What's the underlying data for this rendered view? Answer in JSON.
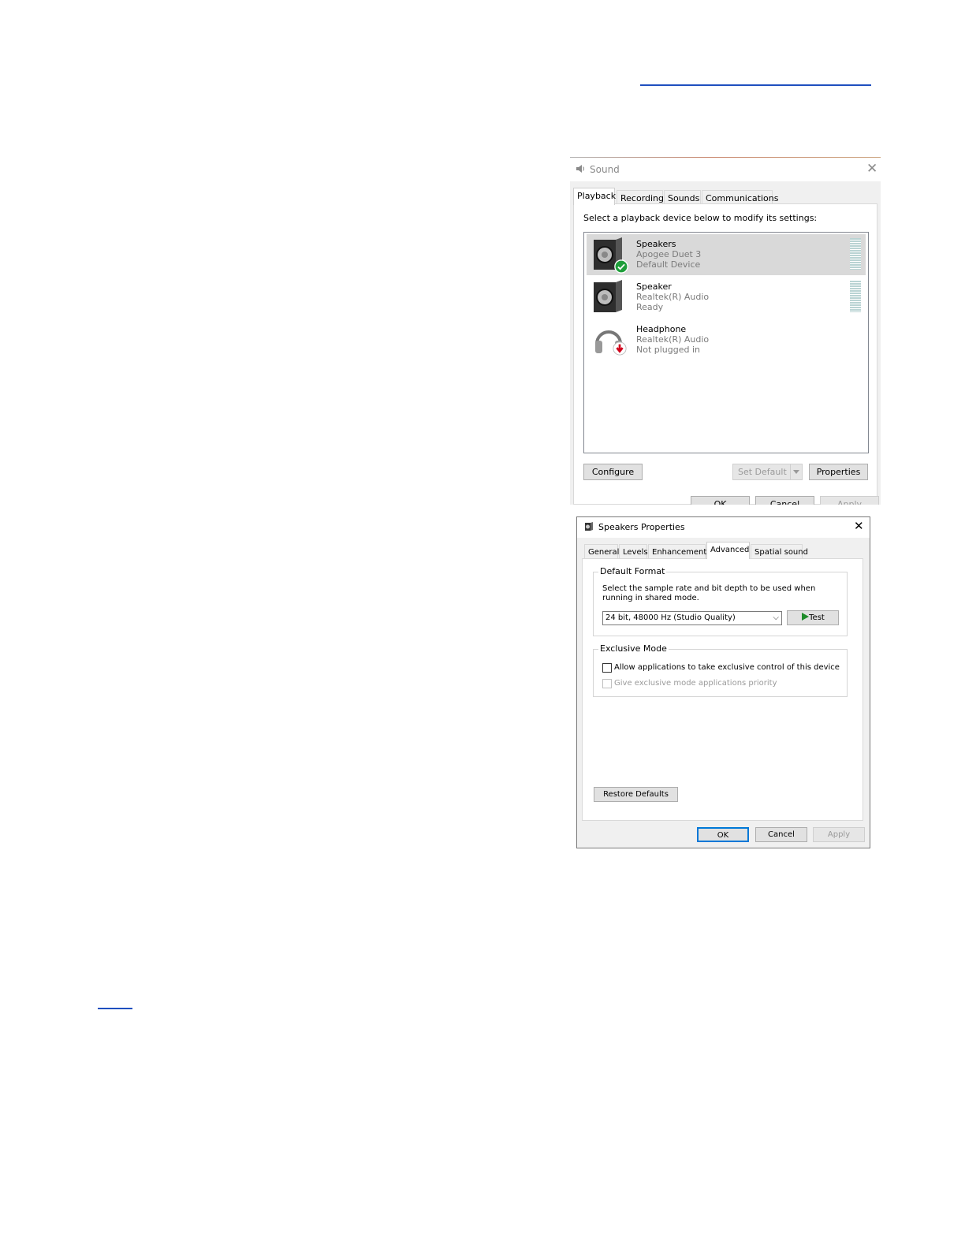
{
  "sound_dialog": {
    "title": "Sound",
    "tabs": [
      {
        "label": "Playback",
        "active": true
      },
      {
        "label": "Recording",
        "active": false
      },
      {
        "label": "Sounds",
        "active": false
      },
      {
        "label": "Communications",
        "active": false
      }
    ],
    "instruction": "Select a playback device below to modify its settings:",
    "devices": [
      {
        "name": "Speakers",
        "driver": "Apogee Duet 3",
        "status": "Default Device",
        "icon": "speaker-icon",
        "badge": "default-check-icon",
        "selected": true
      },
      {
        "name": "Speaker",
        "driver": "Realtek(R) Audio",
        "status": "Ready",
        "icon": "speaker-icon",
        "badge": "",
        "selected": false
      },
      {
        "name": "Headphone",
        "driver": "Realtek(R) Audio",
        "status": "Not plugged in",
        "icon": "headphone-icon",
        "badge": "unplugged-arrow-icon",
        "selected": false
      }
    ],
    "buttons": {
      "configure": "Configure",
      "set_default": "Set Default",
      "properties": "Properties",
      "ok": "OK",
      "cancel": "Cancel",
      "apply": "Apply"
    }
  },
  "properties_dialog": {
    "title": "Speakers Properties",
    "tabs": [
      {
        "label": "General",
        "active": false
      },
      {
        "label": "Levels",
        "active": false
      },
      {
        "label": "Enhancements",
        "active": false
      },
      {
        "label": "Advanced",
        "active": true
      },
      {
        "label": "Spatial sound",
        "active": false
      }
    ],
    "default_format": {
      "group_label": "Default Format",
      "description": "Select the sample rate and bit depth to be used when running in shared mode.",
      "selected_format": "24 bit, 48000 Hz (Studio Quality)",
      "test_button": "Test"
    },
    "exclusive_mode": {
      "group_label": "Exclusive Mode",
      "allow_exclusive": {
        "label": "Allow applications to take exclusive control of this device",
        "checked": false
      },
      "exclusive_priority": {
        "label": "Give exclusive mode applications priority",
        "checked": false,
        "disabled": true
      }
    },
    "buttons": {
      "restore_defaults": "Restore Defaults",
      "ok": "OK",
      "cancel": "Cancel",
      "apply": "Apply"
    }
  },
  "colors": {
    "link_underline": "#1f4fbf",
    "selection": "#d9d9d9",
    "default_check": "#1e9e3a",
    "unplugged_arrow": "#d0021b",
    "test_play": "#1e8c2a",
    "primary_border": "#0078d7"
  }
}
